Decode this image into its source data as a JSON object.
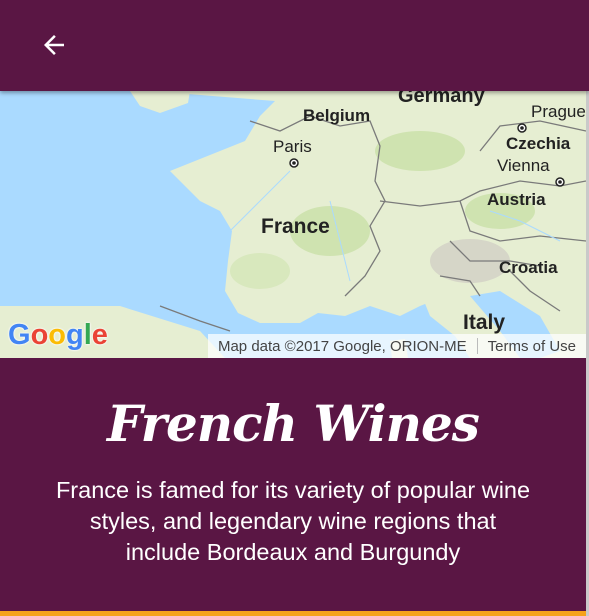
{
  "appbar": {
    "back_icon": "arrow-left-icon"
  },
  "map": {
    "labels": {
      "germany": "Germany",
      "belgium": "Belgium",
      "prague": "Prague",
      "czechia": "Czechia",
      "paris": "Paris",
      "vienna": "Vienna",
      "austria": "Austria",
      "france": "France",
      "croatia": "Croatia",
      "italy": "Italy"
    },
    "google_logo": "Google",
    "attribution": "Map data ©2017 Google, ORION-ME",
    "terms": "Terms of Use"
  },
  "content": {
    "title": "French Wines",
    "description": "France is famed for its variety of popular wine styles, and legendary wine regions that include Bordeaux and Burgundy"
  },
  "colors": {
    "primary": "#5a1644",
    "accent": "#f6a21a",
    "water": "#aadaff",
    "land": "#e8efd5"
  }
}
